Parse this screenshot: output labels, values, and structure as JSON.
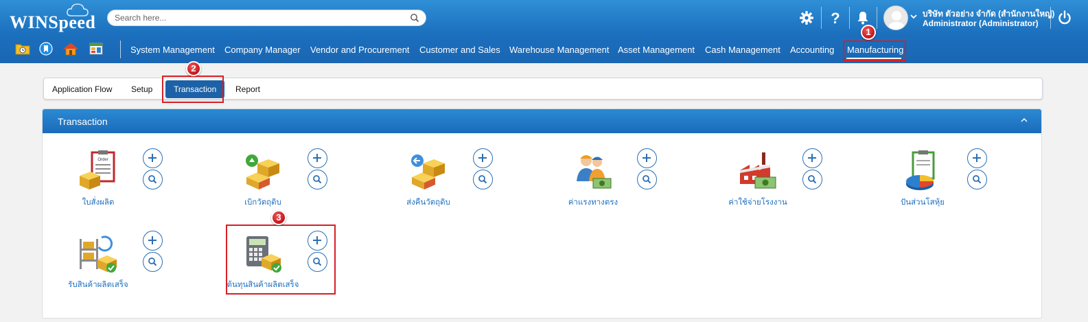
{
  "app": {
    "logo_text": "WINSpeed"
  },
  "search": {
    "placeholder": "Search here..."
  },
  "user": {
    "company": "บริษัท ตัวอย่าง จำกัด (สำนักงานใหญ่)",
    "role": "Administrator (Administrator)"
  },
  "nav": {
    "items": [
      "System Management",
      "Company Manager",
      "Vendor and Procurement",
      "Customer and Sales",
      "Warehouse Management",
      "Asset Management",
      "Cash Management",
      "Accounting",
      "Manufacturing"
    ],
    "active": "Manufacturing"
  },
  "tabs": {
    "items": [
      "Application Flow",
      "Setup",
      "Transaction",
      "Report"
    ],
    "active": "Transaction"
  },
  "panel": {
    "title": "Transaction"
  },
  "tiles": [
    {
      "label": "ใบสั่งผลิต",
      "icon": "production-order-icon"
    },
    {
      "label": "เบิกวัตถุดิบ",
      "icon": "material-issue-icon"
    },
    {
      "label": "ส่งคืนวัตถุดิบ",
      "icon": "material-return-icon"
    },
    {
      "label": "ค่าแรงทางตรง",
      "icon": "direct-labor-icon"
    },
    {
      "label": "ค่าใช้จ่ายโรงงาน",
      "icon": "factory-overhead-icon"
    },
    {
      "label": "ปันส่วนโสหุ้ย",
      "icon": "overhead-allocation-icon"
    },
    {
      "label": "รับสินค้าผลิตเสร็จ",
      "icon": "finished-goods-receipt-icon"
    },
    {
      "label": "ต้นทุนสินค้าผลิตเสร็จ",
      "icon": "finished-goods-cost-icon"
    }
  ],
  "annotations": {
    "step1": "1",
    "step2": "2",
    "step3": "3"
  },
  "colors": {
    "header_blue": "#1b6fbd",
    "link_blue": "#1f6fc1",
    "annotation_red": "#d61f26"
  }
}
